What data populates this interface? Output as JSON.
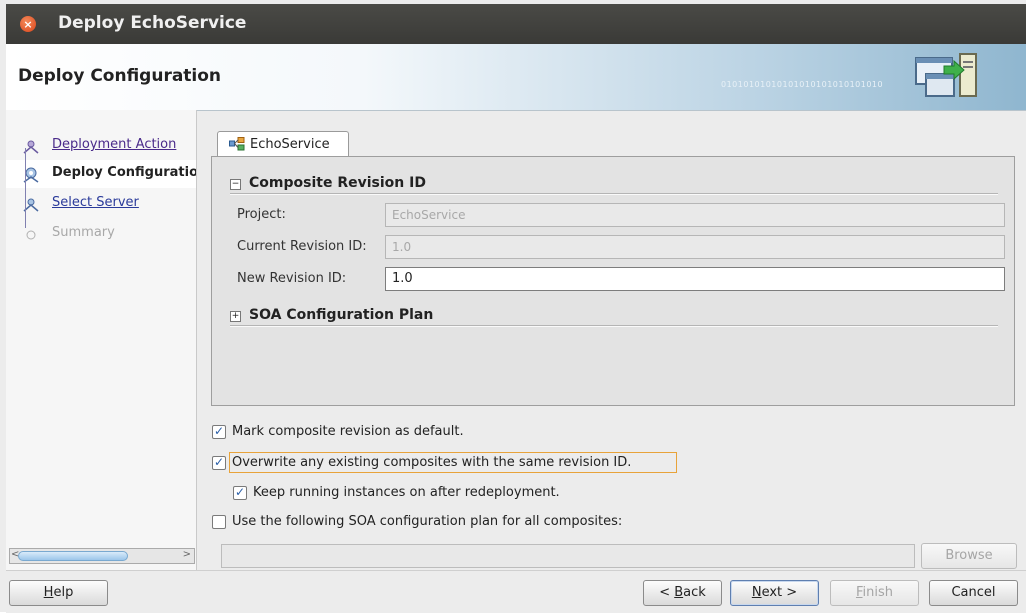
{
  "window": {
    "title": "Deploy EchoService"
  },
  "header": {
    "title": "Deploy Configuration",
    "decoration_text": "01010101010101010101010101010"
  },
  "nav": {
    "items": [
      {
        "label": "Deployment Action",
        "state": "visited"
      },
      {
        "label": "Deploy Configuration",
        "state": "active"
      },
      {
        "label": "Select Server",
        "state": "link"
      },
      {
        "label": "Summary",
        "state": "disabled"
      }
    ]
  },
  "tab": {
    "label": "EchoService"
  },
  "composite_section": {
    "title": "Composite Revision ID",
    "expander": "−",
    "project_label": "Project:",
    "project_value": "EchoService",
    "current_label": "Current Revision ID:",
    "current_value": "1.0",
    "new_label": "New Revision ID:",
    "new_value": "1.0"
  },
  "soa_section": {
    "title": "SOA Configuration Plan",
    "expander": "+"
  },
  "options": {
    "mark_default": {
      "label": "Mark composite revision as default.",
      "checked": true
    },
    "overwrite": {
      "label": "Overwrite any existing composites with the same revision ID.",
      "checked": true
    },
    "keep_running": {
      "label": "Keep running instances on after redeployment.",
      "checked": true
    },
    "use_plan": {
      "label": "Use the following SOA configuration plan for all composites:",
      "checked": false
    }
  },
  "plan": {
    "value": "",
    "browse_label": "Browse"
  },
  "buttons": {
    "help": {
      "pre": "",
      "mnemonic": "H",
      "post": "elp"
    },
    "back": {
      "pre": "< ",
      "mnemonic": "B",
      "post": "ack"
    },
    "next": {
      "pre": "",
      "mnemonic": "N",
      "post": "ext >"
    },
    "finish": {
      "pre": "",
      "mnemonic": "F",
      "post": "inish"
    },
    "cancel": {
      "label": "Cancel"
    }
  },
  "colors": {
    "titlebar": "#3f3f3c",
    "link": "#4a2a8a",
    "checkmark": "#2a5fa8",
    "focus": "#e8a33a",
    "close_button": "#e05a2a"
  },
  "icons": {
    "close": "close-icon",
    "deploy": "deploy-server-icon",
    "composite": "composite-icon",
    "nav_step": "wizard-step-icon"
  }
}
